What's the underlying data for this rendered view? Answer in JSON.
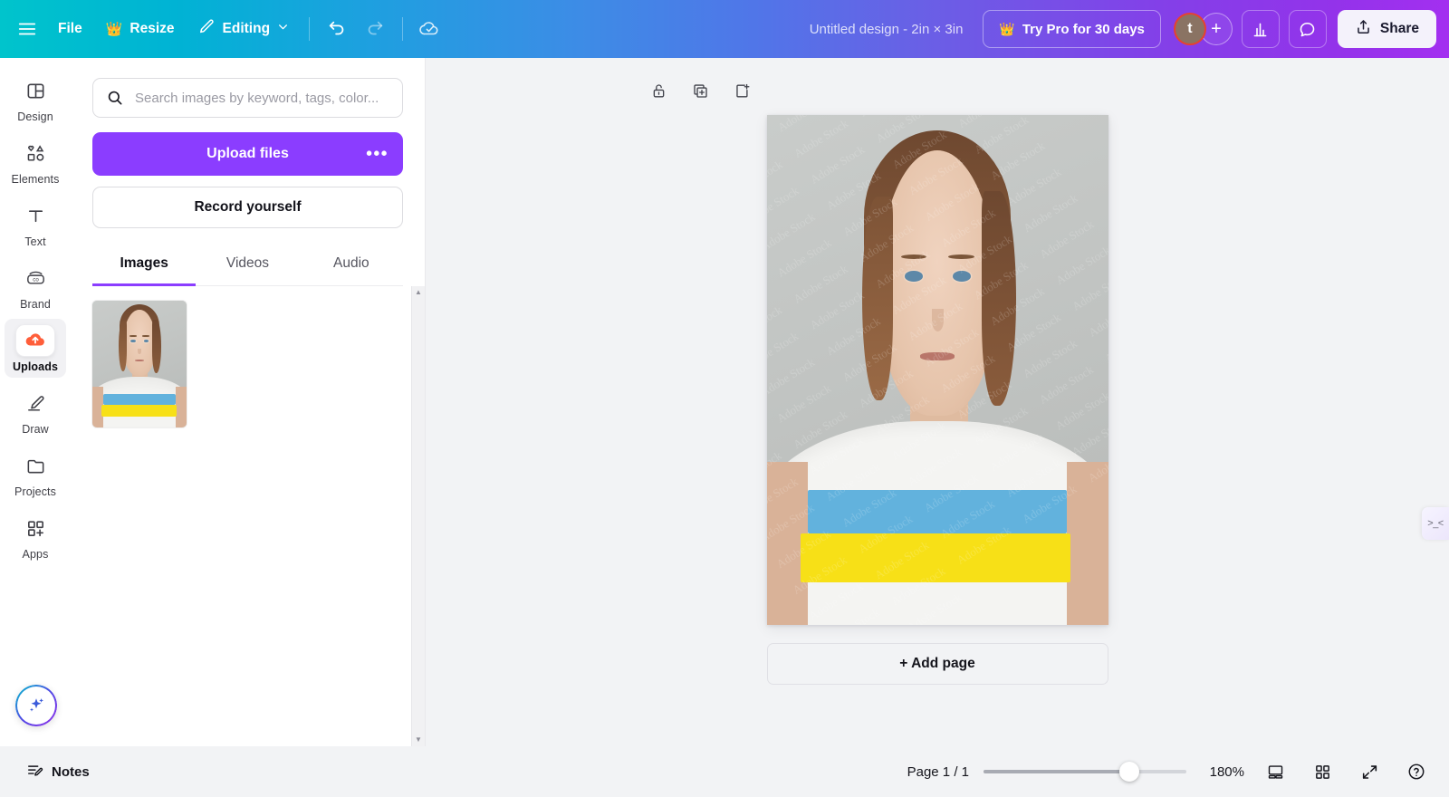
{
  "topbar": {
    "menu_icon": "hamburger-menu-icon",
    "file_label": "File",
    "resize_label": "Resize",
    "resize_crown_icon": "crown-icon",
    "editing_label": "Editing",
    "editing_pencil_icon": "pencil-icon",
    "editing_chevron_icon": "chevron-down-icon",
    "undo_icon": "undo-arrow-icon",
    "redo_icon": "redo-arrow-icon",
    "cloud_saved_icon": "cloud-check-icon",
    "design_title": "Untitled design - 2in × 3in",
    "try_pro_label": "Try Pro for 30 days",
    "try_pro_crown_icon": "crown-icon",
    "avatar_initial": "t",
    "avatar_add_label": "+",
    "analytics_icon": "bar-chart-icon",
    "comments_icon": "comment-bubble-icon",
    "share_label": "Share",
    "share_icon": "share-upload-icon",
    "accent_purple": "#8b3dff",
    "avatar_ring_color": "#e8412e"
  },
  "rail": {
    "items": [
      {
        "label": "Design",
        "icon": "design-layout-icon",
        "active": false
      },
      {
        "label": "Elements",
        "icon": "shapes-icon",
        "active": false
      },
      {
        "label": "Text",
        "icon": "text-t-icon",
        "active": false
      },
      {
        "label": "Brand",
        "icon": "brand-co-icon",
        "active": false
      },
      {
        "label": "Uploads",
        "icon": "upload-cloud-icon",
        "active": true
      },
      {
        "label": "Draw",
        "icon": "pen-draw-icon",
        "active": false
      },
      {
        "label": "Projects",
        "icon": "folder-icon",
        "active": false
      },
      {
        "label": "Apps",
        "icon": "apps-grid-plus-icon",
        "active": false
      }
    ],
    "magic_button_icon": "magic-sparkle-icon"
  },
  "panel": {
    "search_placeholder": "Search images by keyword, tags, color...",
    "search_value": "",
    "search_icon": "search-icon",
    "upload_label": "Upload files",
    "upload_more_icon": "ellipsis-icon",
    "record_label": "Record yourself",
    "tabs": [
      {
        "label": "Images",
        "active": true
      },
      {
        "label": "Videos",
        "active": false
      },
      {
        "label": "Audio",
        "active": false
      }
    ],
    "uploads": [
      {
        "name": "woman-in-ukraine-flag-tshirt"
      }
    ],
    "scroll_up_icon": "scroll-up-arrow-icon",
    "scroll_down_icon": "scroll-down-arrow-icon"
  },
  "canvas": {
    "page_tools": [
      {
        "icon": "unlock-icon",
        "name": "lock-page-button"
      },
      {
        "icon": "duplicate-page-icon",
        "name": "duplicate-page-button"
      },
      {
        "icon": "add-page-icon",
        "name": "insert-page-button"
      }
    ],
    "add_page_label": "+ Add page",
    "collapse_icon": "collapse-panel-icon",
    "collapse_glyph": ">_<",
    "photo": {
      "alt": "Portrait of woman wearing white t-shirt with Ukrainian flag stripes",
      "watermark_text": "Adobe Stock",
      "stripe_blue": "#62b2dd",
      "stripe_yellow": "#f7e017"
    }
  },
  "statusbar": {
    "notes_label": "Notes",
    "notes_icon": "notes-lines-icon",
    "page_counter": "Page 1 / 1",
    "zoom_level": "180%",
    "zoom_fraction": 72,
    "view_notes_icon": "presenter-view-icon",
    "grid_view_icon": "grid-view-icon",
    "fullscreen_icon": "fullscreen-expand-icon",
    "help_icon": "help-question-icon"
  }
}
